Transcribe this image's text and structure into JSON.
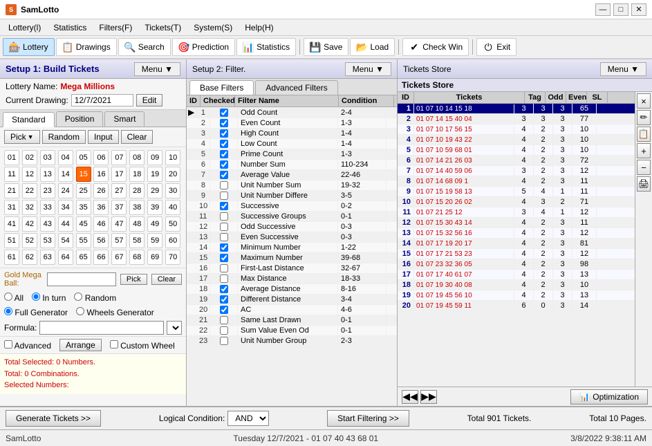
{
  "titlebar": {
    "title": "SamLotto",
    "minimize": "—",
    "maximize": "□",
    "close": "✕"
  },
  "menubar": {
    "items": [
      {
        "id": "lottery",
        "label": "Lottery(l)"
      },
      {
        "id": "statistics",
        "label": "Statistics"
      },
      {
        "id": "filters",
        "label": "Filters(F)"
      },
      {
        "id": "tickets",
        "label": "Tickets(T)"
      },
      {
        "id": "system",
        "label": "System(S)"
      },
      {
        "id": "help",
        "label": "Help(H)"
      }
    ]
  },
  "toolbar": {
    "items": [
      {
        "id": "lottery",
        "label": "Lottery",
        "icon": "🎰",
        "active": true
      },
      {
        "id": "drawings",
        "label": "Drawings",
        "icon": "📋",
        "active": false
      },
      {
        "id": "search",
        "label": "Search",
        "icon": "🔍",
        "active": false
      },
      {
        "id": "prediction",
        "label": "Prediction",
        "icon": "🎯",
        "active": false
      },
      {
        "id": "statistics",
        "label": "Statistics",
        "icon": "📊",
        "active": false
      },
      {
        "id": "save",
        "label": "Save",
        "icon": "💾",
        "active": false
      },
      {
        "id": "load",
        "label": "Load",
        "icon": "📂",
        "active": false
      },
      {
        "id": "checkwin",
        "label": "Check Win",
        "icon": "✔",
        "active": false
      },
      {
        "id": "exit",
        "label": "Exit",
        "icon": "⏻",
        "active": false
      }
    ]
  },
  "left_panel": {
    "header": "Setup 1: Build  Tickets",
    "menu_btn": "Menu ▼",
    "lottery_label": "Lottery  Name:",
    "lottery_name": "Mega Millions",
    "drawing_label": "Current Drawing:",
    "drawing_date": "12/7/2021",
    "edit_btn": "Edit",
    "tabs": [
      "Standard",
      "Position",
      "Smart"
    ],
    "active_tab": "Standard",
    "pick_btn": "Pick ▼",
    "random_btn": "Random",
    "input_btn": "Input",
    "clear_btn": "Clear",
    "numbers": [
      1,
      2,
      3,
      4,
      5,
      6,
      7,
      8,
      9,
      10,
      11,
      12,
      13,
      14,
      15,
      16,
      17,
      18,
      19,
      20,
      21,
      22,
      23,
      24,
      25,
      26,
      27,
      28,
      29,
      30,
      31,
      32,
      33,
      34,
      35,
      36,
      37,
      38,
      39,
      40,
      41,
      42,
      43,
      44,
      45,
      46,
      47,
      48,
      49,
      50,
      51,
      52,
      53,
      54,
      55,
      56,
      57,
      58,
      59,
      60,
      61,
      62,
      63,
      64,
      65,
      66,
      67,
      68,
      69,
      70
    ],
    "selected_numbers": [
      15
    ],
    "gold_ball_label": "Gold Mega Ball:",
    "gold_pick_btn": "Pick",
    "gold_clear_btn": "Clear",
    "radio_all": "All",
    "radio_in_turn": "In turn",
    "radio_random": "Random",
    "full_generator": "Full Generator",
    "wheels_generator": "Wheels Generator",
    "formula_label": "Formula:",
    "advanced_btn": "Advanced",
    "arrange_btn": "Arrange",
    "custom_wheel_btn": "Custom Wheel",
    "stats": {
      "line1": "Total Selected: 0 Numbers.",
      "line2": "Total: 0 Combinations.",
      "line3": "Selected Numbers:"
    }
  },
  "middle_panel": {
    "header": "Setup 2: Filter.",
    "menu_btn": "Menu ▼",
    "tabs": [
      "Base Filters",
      "Advanced Filters"
    ],
    "active_tab": "Base Filters",
    "columns": [
      "ID",
      "Checked",
      "Filter Name",
      "Condition"
    ],
    "filters": [
      {
        "id": 1,
        "checked": true,
        "name": "Odd Count",
        "condition": "2-4"
      },
      {
        "id": 2,
        "checked": true,
        "name": "Even Count",
        "condition": "1-3"
      },
      {
        "id": 3,
        "checked": true,
        "name": "High Count",
        "condition": "1-4"
      },
      {
        "id": 4,
        "checked": true,
        "name": "Low Count",
        "condition": "1-4"
      },
      {
        "id": 5,
        "checked": true,
        "name": "Prime Count",
        "condition": "1-3"
      },
      {
        "id": 6,
        "checked": true,
        "name": "Number Sum",
        "condition": "110-234"
      },
      {
        "id": 7,
        "checked": true,
        "name": "Average Value",
        "condition": "22-46"
      },
      {
        "id": 8,
        "checked": false,
        "name": "Unit Number Sum",
        "condition": "19-32"
      },
      {
        "id": 9,
        "checked": false,
        "name": "Unit Number Differe",
        "condition": "3-5"
      },
      {
        "id": 10,
        "checked": true,
        "name": "Successive",
        "condition": "0-2"
      },
      {
        "id": 11,
        "checked": false,
        "name": "Successive Groups",
        "condition": "0-1"
      },
      {
        "id": 12,
        "checked": false,
        "name": "Odd Successive",
        "condition": "0-3"
      },
      {
        "id": 13,
        "checked": false,
        "name": "Even Successive",
        "condition": "0-3"
      },
      {
        "id": 14,
        "checked": true,
        "name": "Minimum Number",
        "condition": "1-22"
      },
      {
        "id": 15,
        "checked": true,
        "name": "Maximum Number",
        "condition": "39-68"
      },
      {
        "id": 16,
        "checked": false,
        "name": "First-Last Distance",
        "condition": "32-67"
      },
      {
        "id": 17,
        "checked": false,
        "name": "Max Distance",
        "condition": "18-33"
      },
      {
        "id": 18,
        "checked": true,
        "name": "Average Distance",
        "condition": "8-16"
      },
      {
        "id": 19,
        "checked": true,
        "name": "Different Distance",
        "condition": "3-4"
      },
      {
        "id": 20,
        "checked": true,
        "name": "AC",
        "condition": "4-6"
      },
      {
        "id": 21,
        "checked": false,
        "name": "Same Last Drawn",
        "condition": "0-1"
      },
      {
        "id": 22,
        "checked": false,
        "name": "Sum Value Even Od",
        "condition": "0-1"
      },
      {
        "id": 23,
        "checked": false,
        "name": "Unit Number Group",
        "condition": "2-3"
      }
    ]
  },
  "right_panel": {
    "header": "Tickets Store",
    "menu_btn": "Menu ▼",
    "inner_title": "Tickets Store",
    "columns": [
      "ID",
      "Tickets",
      "Tag",
      "Odd",
      "Even",
      "SL"
    ],
    "tickets": [
      {
        "id": 1,
        "numbers": "01 07 10 14 15 18",
        "tag": 3,
        "odd": 3,
        "even": 3,
        "sl": 65,
        "selected": true
      },
      {
        "id": 2,
        "numbers": "01 07 14 15 40 04",
        "tag": 3,
        "odd": 3,
        "even": 3,
        "sl": 77
      },
      {
        "id": 3,
        "numbers": "01 07 10 17 56 15",
        "tag": 4,
        "odd": 2,
        "even": 3,
        "sl": 10
      },
      {
        "id": 4,
        "numbers": "01 07 10 19 43 22",
        "tag": 4,
        "odd": 2,
        "even": 3,
        "sl": 10
      },
      {
        "id": 5,
        "numbers": "01 07 10 59 68 01",
        "tag": 4,
        "odd": 2,
        "even": 3,
        "sl": 10
      },
      {
        "id": 6,
        "numbers": "01 07 14 21 26 03",
        "tag": 4,
        "odd": 2,
        "even": 3,
        "sl": 72
      },
      {
        "id": 7,
        "numbers": "01 07 14 40 59 06",
        "tag": 3,
        "odd": 2,
        "even": 3,
        "sl": 12
      },
      {
        "id": 8,
        "numbers": "01 07 14 68 09 1",
        "tag": 4,
        "odd": 2,
        "even": 3,
        "sl": 11
      },
      {
        "id": 9,
        "numbers": "01 07 15 19 58 13",
        "tag": 5,
        "odd": 4,
        "even": 1,
        "sl": 11
      },
      {
        "id": 10,
        "numbers": "01 07 15 20 26 02",
        "tag": 4,
        "odd": 3,
        "even": 2,
        "sl": 71
      },
      {
        "id": 11,
        "numbers": "01 07 21 25 12",
        "tag": 3,
        "odd": 4,
        "even": 1,
        "sl": 12
      },
      {
        "id": 12,
        "numbers": "01 07 15 30 43 14",
        "tag": 4,
        "odd": 2,
        "even": 3,
        "sl": 11
      },
      {
        "id": 13,
        "numbers": "01 07 15 32 56 16",
        "tag": 4,
        "odd": 2,
        "even": 3,
        "sl": 12
      },
      {
        "id": 14,
        "numbers": "01 07 17 19 20 17",
        "tag": 4,
        "odd": 2,
        "even": 3,
        "sl": 81
      },
      {
        "id": 15,
        "numbers": "01 07 17 21 53 23",
        "tag": 4,
        "odd": 2,
        "even": 3,
        "sl": 12
      },
      {
        "id": 16,
        "numbers": "01 07 23 32 36 05",
        "tag": 4,
        "odd": 2,
        "even": 3,
        "sl": 98
      },
      {
        "id": 17,
        "numbers": "01 07 17 40 61 07",
        "tag": 4,
        "odd": 2,
        "even": 3,
        "sl": 13
      },
      {
        "id": 18,
        "numbers": "01 07 19 30 40 08",
        "tag": 4,
        "odd": 2,
        "even": 3,
        "sl": 10
      },
      {
        "id": 19,
        "numbers": "01 07 19 45 56 10",
        "tag": 4,
        "odd": 2,
        "even": 3,
        "sl": 13
      },
      {
        "id": 20,
        "numbers": "01 07 19 45 59 11",
        "tag": 6,
        "odd": 0,
        "even": 3,
        "sl": 14
      }
    ],
    "side_buttons": [
      "×",
      "🖊",
      "📋",
      "+",
      "−",
      "🖨"
    ],
    "nav_prev": "◀◀",
    "nav_next": "▶▶",
    "optimize_btn": "Optimization"
  },
  "bottom_bar": {
    "generate_btn": "Generate Tickets >>",
    "logical_label": "Logical Condition:",
    "logical_value": "AND",
    "start_btn": "Start Filtering >>",
    "total_tickets": "Total 901 Tickets.",
    "total_pages": "Total 10 Pages."
  },
  "status_bar": {
    "left": "SamLotto",
    "mid": "Tuesday 12/7/2021 - 01 07 40 43 68 01",
    "right": "3/8/2022  9:38:11 AM"
  }
}
